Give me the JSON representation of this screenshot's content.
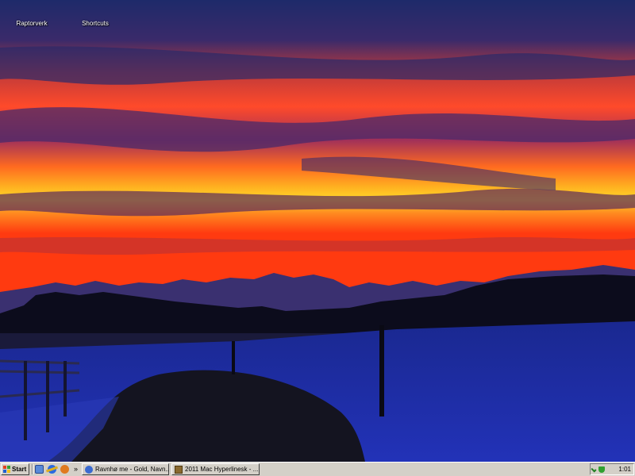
{
  "desktop": {
    "icons": [
      {
        "label": "Raptorverk",
        "icon": "folder-icon"
      },
      {
        "label": "Shortcuts",
        "icon": "shortcut-icon"
      }
    ],
    "wallpaper": "sunset-over-snowy-mountains"
  },
  "taskbar": {
    "start_label": "Start",
    "quick_launch": [
      {
        "icon": "show-desktop-icon"
      },
      {
        "icon": "internet-explorer-icon"
      },
      {
        "icon": "media-player-icon"
      }
    ],
    "overflow_label": "»",
    "tasks": [
      {
        "label": "Ravnhø me - Gold, Navn...",
        "icon": "browser-icon"
      },
      {
        "label": "2011 Mac Hyperlinesk - ...",
        "icon": "archive-icon"
      }
    ],
    "clock": "1:01"
  },
  "colors": {
    "taskbar": "#d4d0c8",
    "sky_top": "#1e2a6a",
    "sky_glow": "#ff5a18",
    "snow": "#1c2a9a"
  }
}
